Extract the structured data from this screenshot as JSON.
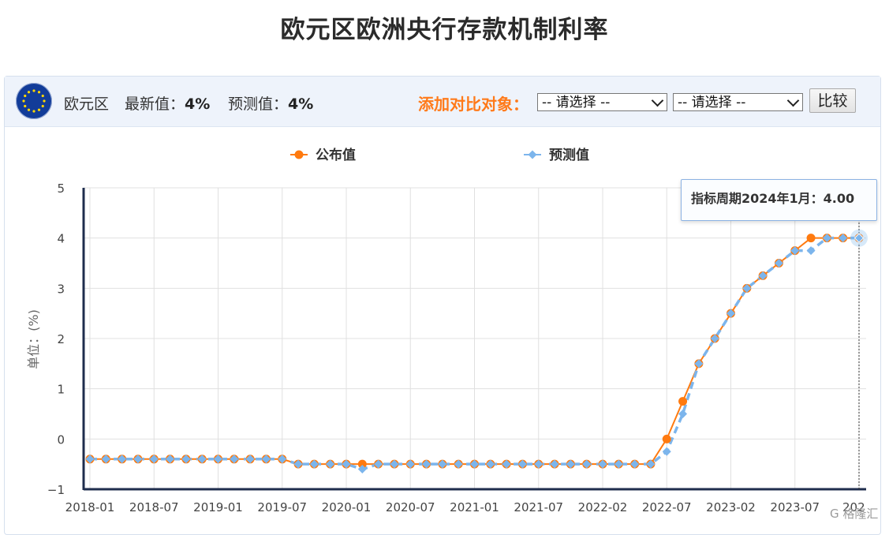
{
  "page": {
    "title": "欧元区欧洲央行存款机制利率"
  },
  "toolbar": {
    "flag_icon": "eu-flag-icon",
    "region": "欧元区",
    "latest_label": "最新值：",
    "latest_value": "4%",
    "forecast_label": "预测值：",
    "forecast_value": "4%",
    "compare_label": "添加对比对象：",
    "select1_value": "-- 请选择 --",
    "select2_value": "-- 请选择 --",
    "compare_button": "比较"
  },
  "tooltip": {
    "text": "指标周期2024年1月：4.00"
  },
  "watermark": "G 格隆汇",
  "colors": {
    "published": "#ff7a0f",
    "forecast": "#7cb5ec",
    "axis": "#1f2d4d",
    "grid": "#e0e0e0",
    "accent": "#ff7a1a"
  },
  "chart_data": {
    "type": "line",
    "ylabel": "单位：(%)",
    "ylim": [
      -1,
      5
    ],
    "yticks": [
      "5",
      "4",
      "3",
      "2",
      "1",
      "0",
      "−1"
    ],
    "xtick_labels": [
      "2018-01",
      "2018-07",
      "2019-01",
      "2019-07",
      "2020-01",
      "2020-07",
      "2021-01",
      "2021-07",
      "2022-02",
      "2022-07",
      "2023-02",
      "2023-07",
      "202"
    ],
    "legend": [
      "公布值",
      "预测值"
    ],
    "legend_position": "top",
    "grid": true,
    "x": [
      "2018-01",
      "2018-03",
      "2018-04",
      "2018-06",
      "2018-07",
      "2018-09",
      "2018-10",
      "2018-12",
      "2019-01",
      "2019-03",
      "2019-04",
      "2019-06",
      "2019-07",
      "2019-09",
      "2019-10",
      "2019-12",
      "2020-01",
      "2020-03",
      "2020-04",
      "2020-06",
      "2020-07",
      "2020-09",
      "2020-10",
      "2020-12",
      "2021-01",
      "2021-03",
      "2021-04",
      "2021-06",
      "2021-07",
      "2021-09",
      "2021-10",
      "2021-12",
      "2022-02",
      "2022-03",
      "2022-04",
      "2022-06",
      "2022-07",
      "2022-09",
      "2022-10",
      "2022-12",
      "2023-02",
      "2023-03",
      "2023-05",
      "2023-06",
      "2023-07",
      "2023-09",
      "2023-10",
      "2023-12",
      "2024-01"
    ],
    "series": [
      {
        "name": "公布值",
        "values": [
          -0.4,
          -0.4,
          -0.4,
          -0.4,
          -0.4,
          -0.4,
          -0.4,
          -0.4,
          -0.4,
          -0.4,
          -0.4,
          -0.4,
          -0.4,
          -0.5,
          -0.5,
          -0.5,
          -0.5,
          -0.5,
          -0.5,
          -0.5,
          -0.5,
          -0.5,
          -0.5,
          -0.5,
          -0.5,
          -0.5,
          -0.5,
          -0.5,
          -0.5,
          -0.5,
          -0.5,
          -0.5,
          -0.5,
          -0.5,
          -0.5,
          -0.5,
          0.0,
          0.75,
          1.5,
          2.0,
          2.5,
          3.0,
          3.25,
          3.5,
          3.75,
          4.0,
          4.0,
          4.0,
          4.0
        ]
      },
      {
        "name": "预测值",
        "values": [
          -0.4,
          -0.4,
          -0.4,
          -0.4,
          -0.4,
          -0.4,
          -0.4,
          -0.4,
          -0.4,
          -0.4,
          -0.4,
          -0.4,
          -0.4,
          -0.5,
          -0.5,
          -0.5,
          -0.5,
          -0.6,
          -0.5,
          -0.5,
          -0.5,
          -0.5,
          -0.5,
          -0.5,
          -0.5,
          -0.5,
          -0.5,
          -0.5,
          -0.5,
          -0.5,
          -0.5,
          -0.5,
          -0.5,
          -0.5,
          -0.5,
          -0.5,
          -0.25,
          0.5,
          1.5,
          2.0,
          2.5,
          3.0,
          3.25,
          3.5,
          3.75,
          3.75,
          4.0,
          4.0,
          4.0
        ]
      }
    ],
    "highlight": "2024-01"
  }
}
